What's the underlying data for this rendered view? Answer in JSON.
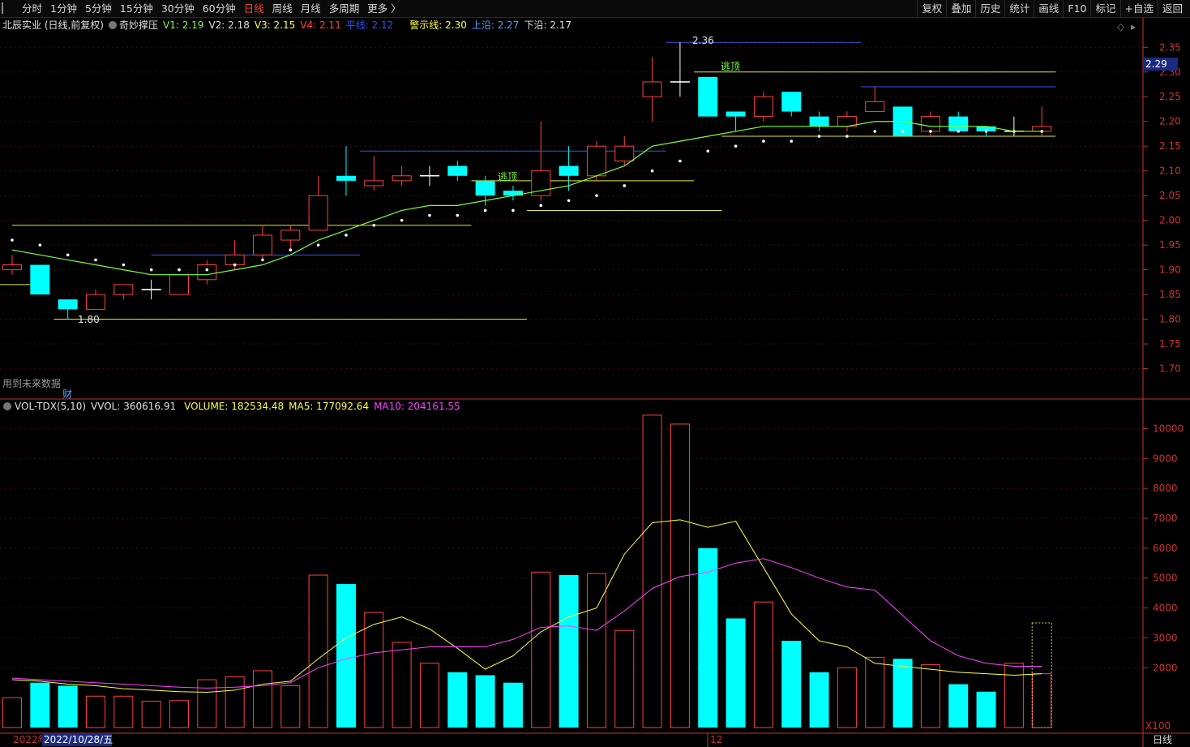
{
  "toolbar": {
    "periods": [
      "分时",
      "1分钟",
      "5分钟",
      "15分钟",
      "30分钟",
      "60分钟",
      "日线",
      "周线",
      "月线",
      "多周期",
      "更多 〉"
    ],
    "active_period": "日线",
    "tools": [
      "复权",
      "叠加",
      "历史",
      "统计",
      "画线",
      "F10",
      "标记",
      "+自选",
      "返回"
    ]
  },
  "price_info": {
    "stock": "北辰实业 (日线,前复权)",
    "indicator": "奇妙撑压",
    "v1": "V1: 2.19",
    "v2": "V2: 2.18",
    "v3": "V3: 2.15",
    "v4": "V4: 2.11",
    "avg": "平线: 2.12",
    "warn": "警示线: 2.30",
    "upper": "上沿: 2.27",
    "lower": "下沿: 2.17"
  },
  "vol_info": {
    "name": "VOL-TDX(5,10)",
    "vvol": "VVOL: 360616.91",
    "volume": "VOLUME: 182534.48",
    "ma5": "MA5: 177092.64",
    "ma10": "MA10: 204161.55"
  },
  "annotations": {
    "high_label": "2.36",
    "low_label": "1.80",
    "escape_top": "逃顶",
    "future_data_note": "用到未来数据",
    "cai": "财",
    "current_price": "2.29",
    "x100": "X100",
    "period_label": "日线",
    "year_label": "2022年",
    "date_label": "2022/10/28/五",
    "month_label": "12"
  },
  "colors": {
    "up": "#ff4040",
    "down": "#00ffff",
    "ma_green": "#7dff3a",
    "yellow": "#ffff40",
    "blue": "#4060ff",
    "magenta": "#ff40ff",
    "axis_red": "#c83030"
  },
  "chart_data": [
    {
      "type": "candlestick",
      "title": "北辰实业 (日线,前复权)",
      "y_ticks": [
        2.35,
        2.3,
        2.25,
        2.2,
        2.15,
        2.1,
        2.05,
        2.0,
        1.95,
        1.9,
        1.85,
        1.8,
        1.75,
        1.7
      ],
      "ylim": [
        1.65,
        2.38
      ],
      "candles": [
        {
          "o": 1.9,
          "h": 1.93,
          "l": 1.89,
          "c": 1.91
        },
        {
          "o": 1.91,
          "h": 1.91,
          "l": 1.85,
          "c": 1.85
        },
        {
          "o": 1.84,
          "h": 1.84,
          "l": 1.8,
          "c": 1.82
        },
        {
          "o": 1.82,
          "h": 1.86,
          "l": 1.82,
          "c": 1.85
        },
        {
          "o": 1.85,
          "h": 1.87,
          "l": 1.84,
          "c": 1.87
        },
        {
          "o": 1.86,
          "h": 1.88,
          "l": 1.84,
          "c": 1.86
        },
        {
          "o": 1.85,
          "h": 1.89,
          "l": 1.85,
          "c": 1.89
        },
        {
          "o": 1.88,
          "h": 1.92,
          "l": 1.87,
          "c": 1.91
        },
        {
          "o": 1.91,
          "h": 1.96,
          "l": 1.9,
          "c": 1.93
        },
        {
          "o": 1.93,
          "h": 1.99,
          "l": 1.92,
          "c": 1.97
        },
        {
          "o": 1.96,
          "h": 1.99,
          "l": 1.94,
          "c": 1.98
        },
        {
          "o": 1.98,
          "h": 2.09,
          "l": 1.98,
          "c": 2.05
        },
        {
          "o": 2.09,
          "h": 2.15,
          "l": 2.05,
          "c": 2.08
        },
        {
          "o": 2.07,
          "h": 2.13,
          "l": 2.06,
          "c": 2.08
        },
        {
          "o": 2.08,
          "h": 2.11,
          "l": 2.07,
          "c": 2.09
        },
        {
          "o": 2.09,
          "h": 2.11,
          "l": 2.07,
          "c": 2.09
        },
        {
          "o": 2.11,
          "h": 2.12,
          "l": 2.08,
          "c": 2.09
        },
        {
          "o": 2.08,
          "h": 2.09,
          "l": 2.03,
          "c": 2.05
        },
        {
          "o": 2.06,
          "h": 2.07,
          "l": 2.04,
          "c": 2.05
        },
        {
          "o": 2.05,
          "h": 2.2,
          "l": 2.04,
          "c": 2.1
        },
        {
          "o": 2.11,
          "h": 2.15,
          "l": 2.06,
          "c": 2.09
        },
        {
          "o": 2.09,
          "h": 2.16,
          "l": 2.08,
          "c": 2.15
        },
        {
          "o": 2.12,
          "h": 2.17,
          "l": 2.11,
          "c": 2.15
        },
        {
          "o": 2.25,
          "h": 2.33,
          "l": 2.2,
          "c": 2.28
        },
        {
          "o": 2.28,
          "h": 2.36,
          "l": 2.25,
          "c": 2.28
        },
        {
          "o": 2.29,
          "h": 2.29,
          "l": 2.21,
          "c": 2.21
        },
        {
          "o": 2.22,
          "h": 2.22,
          "l": 2.18,
          "c": 2.21
        },
        {
          "o": 2.21,
          "h": 2.26,
          "l": 2.2,
          "c": 2.25
        },
        {
          "o": 2.26,
          "h": 2.26,
          "l": 2.21,
          "c": 2.22
        },
        {
          "o": 2.21,
          "h": 2.22,
          "l": 2.18,
          "c": 2.19
        },
        {
          "o": 2.19,
          "h": 2.22,
          "l": 2.18,
          "c": 2.21
        },
        {
          "o": 2.22,
          "h": 2.27,
          "l": 2.22,
          "c": 2.24
        },
        {
          "o": 2.23,
          "h": 2.23,
          "l": 2.17,
          "c": 2.17
        },
        {
          "o": 2.18,
          "h": 2.22,
          "l": 2.17,
          "c": 2.21
        },
        {
          "o": 2.21,
          "h": 2.22,
          "l": 2.18,
          "c": 2.18
        },
        {
          "o": 2.19,
          "h": 2.19,
          "l": 2.17,
          "c": 2.18
        },
        {
          "o": 2.18,
          "h": 2.21,
          "l": 2.17,
          "c": 2.18
        },
        {
          "o": 2.18,
          "h": 2.23,
          "l": 2.17,
          "c": 2.19
        }
      ],
      "ma_green": [
        1.94,
        1.93,
        1.92,
        1.91,
        1.9,
        1.89,
        1.89,
        1.89,
        1.9,
        1.91,
        1.93,
        1.96,
        1.98,
        2.0,
        2.02,
        2.03,
        2.03,
        2.04,
        2.05,
        2.06,
        2.07,
        2.09,
        2.11,
        2.15,
        2.16,
        2.17,
        2.18,
        2.19,
        2.19,
        2.19,
        2.19,
        2.2,
        2.2,
        2.19,
        2.19,
        2.19,
        2.18,
        2.18
      ],
      "white_dots": [
        1.96,
        1.95,
        1.93,
        1.92,
        1.91,
        1.9,
        1.9,
        1.9,
        1.91,
        1.92,
        1.94,
        1.95,
        1.97,
        1.99,
        2.0,
        2.01,
        2.01,
        2.02,
        2.02,
        2.03,
        2.04,
        2.05,
        2.07,
        2.1,
        2.12,
        2.14,
        2.15,
        2.16,
        2.16,
        2.17,
        2.17,
        2.18,
        2.18,
        2.18,
        2.18,
        2.18,
        2.18,
        2.18
      ],
      "h_lines": [
        {
          "y": 1.99,
          "from": 0,
          "to": 16.5,
          "color": "yellow"
        },
        {
          "y": 1.93,
          "from": 5,
          "to": 12.5,
          "color": "blue"
        },
        {
          "y": 1.87,
          "from": -0.5,
          "to": 1,
          "color": "yellow"
        },
        {
          "y": 1.8,
          "from": 1.5,
          "to": 18.5,
          "color": "yellow"
        },
        {
          "y": 2.14,
          "from": 12.5,
          "to": 23.5,
          "color": "blue"
        },
        {
          "y": 2.08,
          "from": 16.5,
          "to": 24.5,
          "color": "yellow"
        },
        {
          "y": 2.02,
          "from": 18.5,
          "to": 25.5,
          "color": "yellow"
        },
        {
          "y": 2.36,
          "from": 23.5,
          "to": 30.5,
          "color": "blue"
        },
        {
          "y": 2.3,
          "from": 24.5,
          "to": 37.5,
          "color": "yellow"
        },
        {
          "y": 2.27,
          "from": 30.5,
          "to": 37.5,
          "color": "blue"
        },
        {
          "y": 2.17,
          "from": 25.5,
          "to": 37.5,
          "color": "yellow"
        }
      ]
    },
    {
      "type": "bar",
      "title": "VOL-TDX(5,10)",
      "y_ticks": [
        10000,
        9000,
        8000,
        7000,
        6000,
        5000,
        4000,
        3000,
        2000
      ],
      "ylim": [
        0,
        10500
      ],
      "volumes": [
        1000,
        1500,
        1400,
        1050,
        1050,
        880,
        900,
        1600,
        1700,
        1900,
        1400,
        5100,
        4800,
        3850,
        2850,
        2150,
        1850,
        1750,
        1500,
        5200,
        5100,
        5150,
        3250,
        10450,
        10150,
        6000,
        3650,
        4200,
        2900,
        1850,
        2000,
        2350,
        2300,
        2100,
        1450,
        1200,
        2150,
        1800
      ],
      "ma5": [
        1600,
        1550,
        1450,
        1400,
        1300,
        1250,
        1200,
        1180,
        1250,
        1450,
        1550,
        2300,
        3000,
        3450,
        3700,
        3300,
        2650,
        1950,
        2400,
        3200,
        3700,
        4000,
        5800,
        6850,
        6950,
        6700,
        6900,
        5350,
        3800,
        2900,
        2700,
        2150,
        2050,
        1950,
        1850,
        1800,
        1750,
        1800
      ],
      "ma10": [
        1650,
        1600,
        1550,
        1500,
        1450,
        1400,
        1350,
        1320,
        1350,
        1400,
        1500,
        2000,
        2300,
        2500,
        2600,
        2700,
        2700,
        2700,
        2950,
        3350,
        3400,
        3250,
        3900,
        4650,
        5050,
        5200,
        5500,
        5650,
        5350,
        5000,
        4700,
        4600,
        3750,
        2900,
        2400,
        2150,
        2050,
        2050
      ]
    }
  ]
}
